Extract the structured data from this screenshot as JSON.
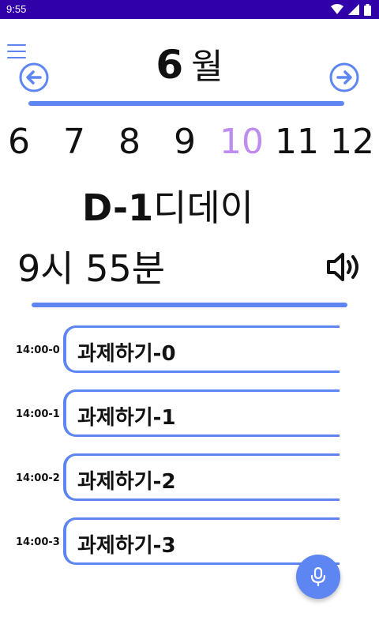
{
  "status_bar": {
    "time": "9:55",
    "icons": [
      "wifi-icon",
      "signal-icon",
      "battery-icon"
    ]
  },
  "header": {
    "menu_icon": "menu-icon",
    "month_number": "6",
    "month_unit": "월",
    "prev_icon": "arrow-left-circle-icon",
    "next_icon": "arrow-right-circle-icon"
  },
  "month_strip": {
    "months": [
      "6",
      "7",
      "8",
      "9",
      "10",
      "11",
      "12"
    ],
    "selected": "10"
  },
  "dday": {
    "label": "D-1",
    "suffix": "디데이"
  },
  "clock": {
    "text": "9시 55분",
    "speaker_icon": "speaker-icon"
  },
  "tasks": [
    {
      "time": "14:00-0",
      "title": "과제하기-0"
    },
    {
      "time": "14:00-1",
      "title": "과제하기-1"
    },
    {
      "time": "14:00-2",
      "title": "과제하기-2"
    },
    {
      "time": "14:00-3",
      "title": "과제하기-3"
    }
  ],
  "fab": {
    "icon": "microphone-icon"
  },
  "colors": {
    "accent": "#5d86f2",
    "selected_month": "#bf8cf0",
    "status_bar": "#3000a8"
  }
}
